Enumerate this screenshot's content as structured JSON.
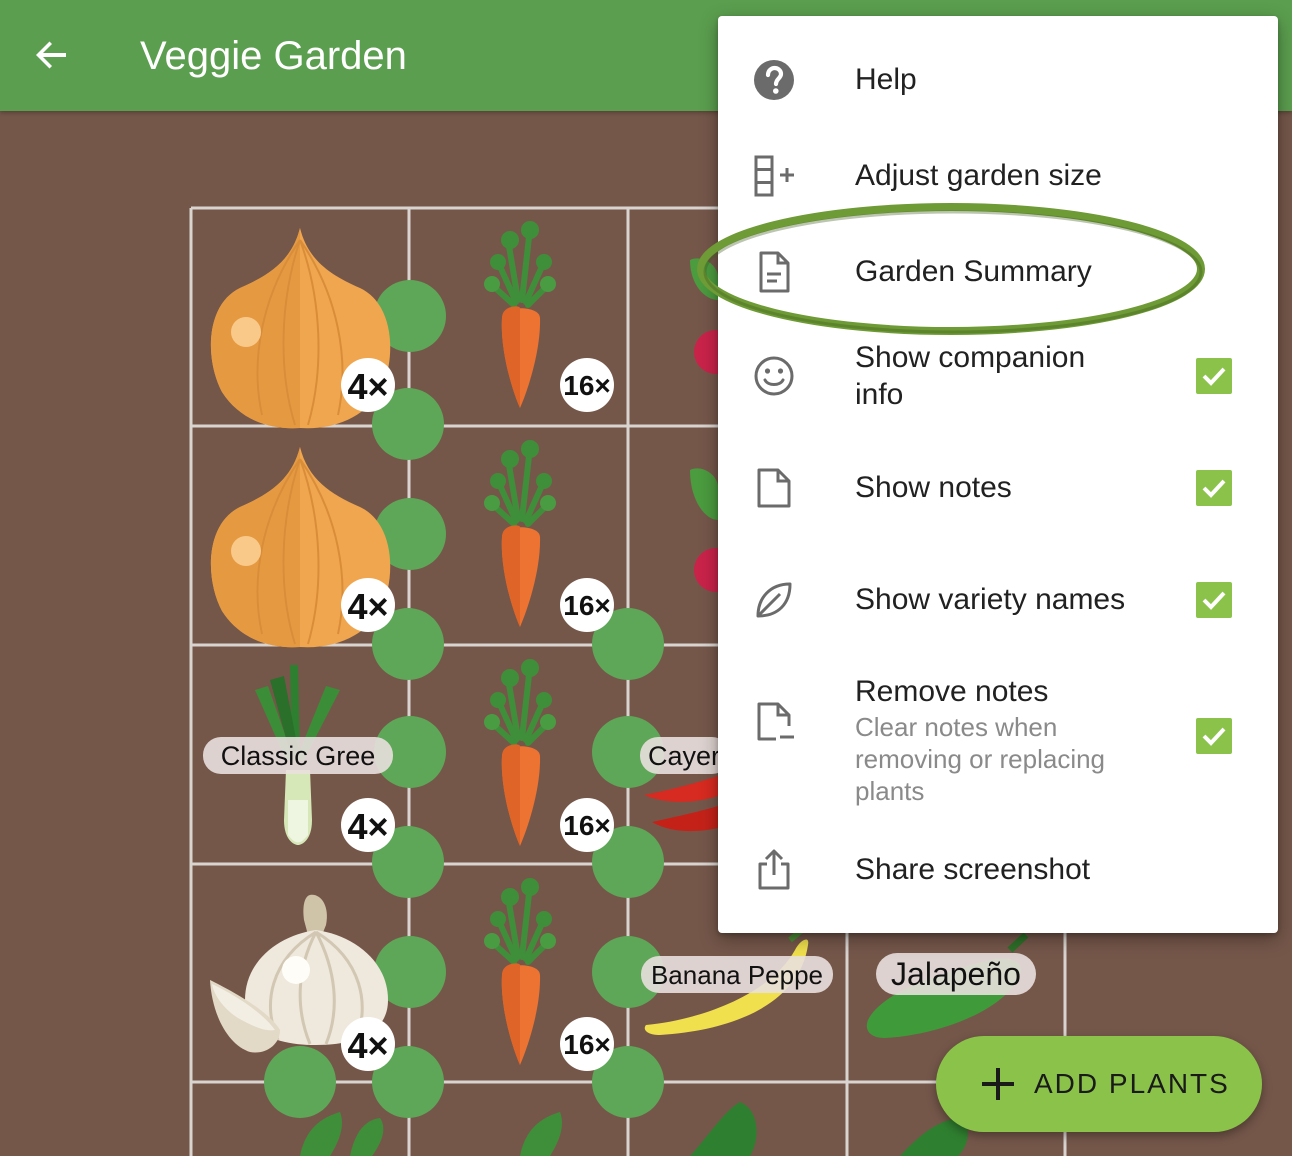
{
  "appbar": {
    "title": "Veggie Garden",
    "back_icon": "arrow-back-icon"
  },
  "colors": {
    "appbar": "#5b9e4f",
    "soil": "#75574a",
    "accent": "#8bc34a",
    "grid_line": "#d9d4d0",
    "companion_dot": "#5ea758"
  },
  "garden": {
    "counts": {
      "onion": "4×",
      "carrot": "16×",
      "leek": "4×",
      "garlic": "4×"
    },
    "variety_labels": {
      "leek": "Classic Gree",
      "cayenne": "Cayer",
      "banana": "Banana Peppe",
      "jalapeno": "Jalapeño"
    }
  },
  "menu": {
    "items": [
      {
        "label": "Help",
        "icon": "help-icon"
      },
      {
        "label": "Adjust garden size",
        "icon": "adjust-size-icon"
      },
      {
        "label": "Garden Summary",
        "icon": "document-icon",
        "highlighted": true
      },
      {
        "label": "Show companion",
        "label2": "info",
        "icon": "smiley-icon",
        "checked": true
      },
      {
        "label": "Show notes",
        "icon": "note-icon",
        "checked": true
      },
      {
        "label": "Show variety names",
        "icon": "leaf-icon",
        "checked": true
      },
      {
        "label": "Remove notes",
        "sub1": "Clear notes when",
        "sub2": "removing or replacing",
        "sub3": "plants",
        "icon": "remove-note-icon",
        "checked": true
      },
      {
        "label": "Share screenshot",
        "icon": "share-icon"
      }
    ]
  },
  "fab": {
    "label": "ADD PLANTS",
    "icon": "plus-icon"
  }
}
